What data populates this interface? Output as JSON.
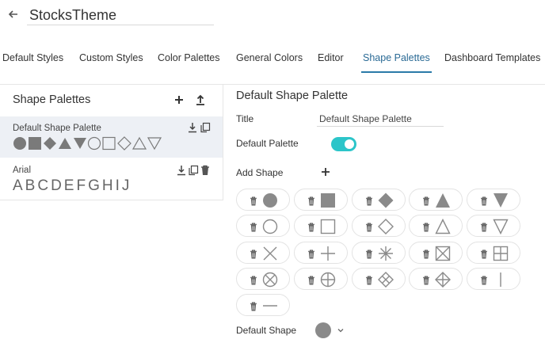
{
  "header": {
    "theme_name": "StocksTheme",
    "back_icon": "arrow-left-icon"
  },
  "tabs": [
    {
      "label": "Default Styles",
      "active": false
    },
    {
      "label": "Custom Styles",
      "active": false
    },
    {
      "label": "Color Palettes",
      "active": false
    },
    {
      "label": "General Colors",
      "active": false
    },
    {
      "label": "Editor",
      "active": false
    },
    {
      "label": "Shape Palettes",
      "active": true
    },
    {
      "label": "Dashboard Templates",
      "active": false
    }
  ],
  "left_panel": {
    "title": "Shape Palettes",
    "add_icon": "plus-icon",
    "upload_icon": "upload-icon",
    "palettes": [
      {
        "name": "Default Shape Palette",
        "selected": true,
        "shapes": [
          "circle-filled",
          "square-filled",
          "diamond-filled",
          "triangle-up-filled",
          "triangle-down-filled",
          "circle",
          "square",
          "diamond",
          "triangle-up",
          "triangle-down"
        ]
      },
      {
        "name": "Arial",
        "selected": false,
        "letters": "ABCDEFGHIJ"
      }
    ]
  },
  "right_panel": {
    "title": "Default Shape Palette",
    "title_label": "Title",
    "title_value": "Default Shape Palette",
    "default_palette_label": "Default Palette",
    "default_palette_on": true,
    "add_shape_label": "Add Shape",
    "default_shape_label": "Default Shape",
    "default_shape": "circle-filled",
    "shapes": [
      "circle-filled",
      "square-filled",
      "diamond-filled",
      "triangle-up-filled",
      "triangle-down-filled",
      "circle",
      "square",
      "diamond",
      "triangle-up",
      "triangle-down",
      "x",
      "plus",
      "asterisk",
      "square-x",
      "square-plus",
      "circle-x",
      "circle-plus",
      "diamond-x",
      "diamond-plus",
      "vertical-line",
      "horizontal-line"
    ]
  },
  "colors": {
    "accent": "#2a7aa8",
    "toggle": "#2cc5c9",
    "shape": "#8a8a8a",
    "selected_row": "#edf0f5"
  }
}
